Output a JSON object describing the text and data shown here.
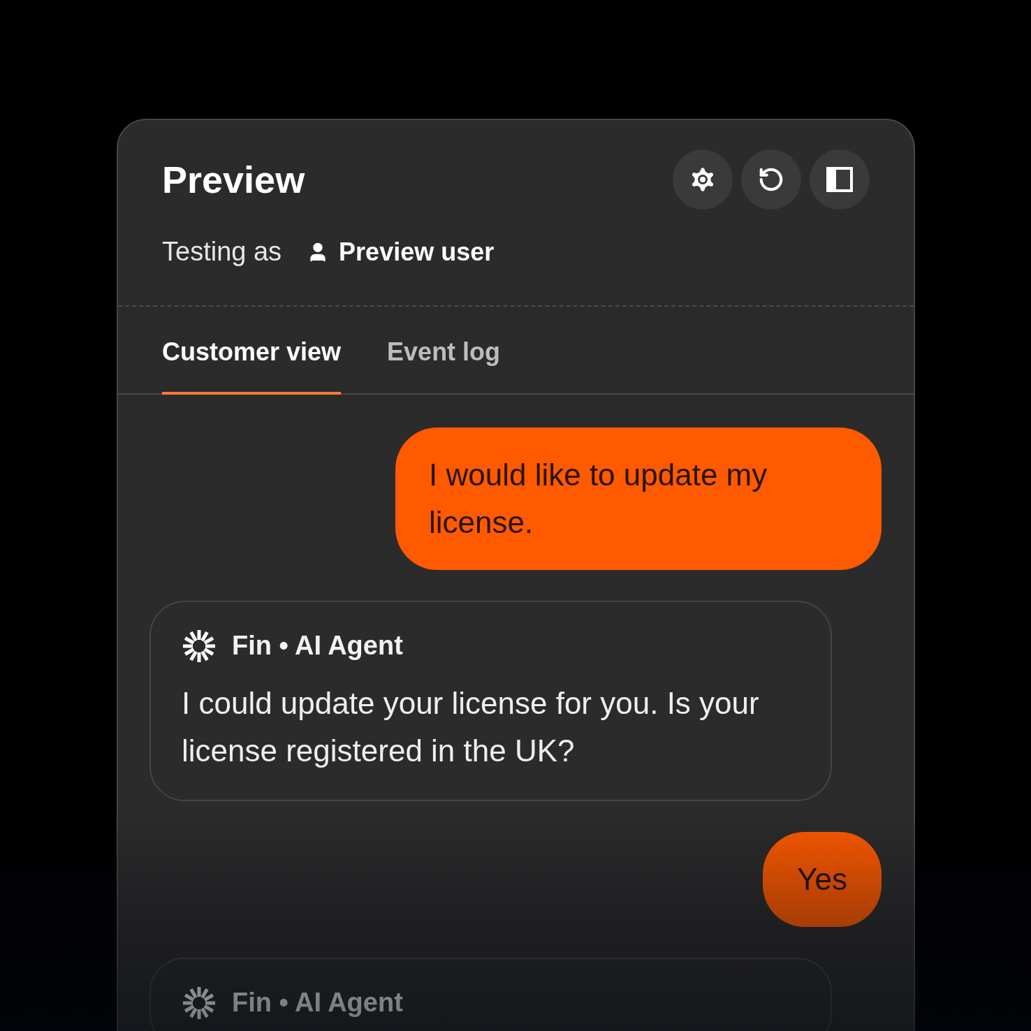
{
  "header": {
    "title": "Preview",
    "actions": [
      {
        "kind": "settings"
      },
      {
        "kind": "reset"
      },
      {
        "kind": "panel"
      }
    ]
  },
  "tester": {
    "label": "Testing as",
    "user": "Preview user"
  },
  "tabs": [
    {
      "label": "Customer view",
      "selected": true
    },
    {
      "label": "Event log",
      "selected": false
    }
  ],
  "messages": [
    {
      "kind": "user",
      "text": "I would like to update my license."
    },
    {
      "kind": "agent",
      "sender": "Fin",
      "separator": "•",
      "role": "AI Agent",
      "text": "I could update your license for you. Is your license registered in the UK?"
    },
    {
      "kind": "user",
      "text": "Yes"
    },
    {
      "kind": "agent",
      "sender": "Fin",
      "separator": "•",
      "role": "AI Agent"
    }
  ]
}
